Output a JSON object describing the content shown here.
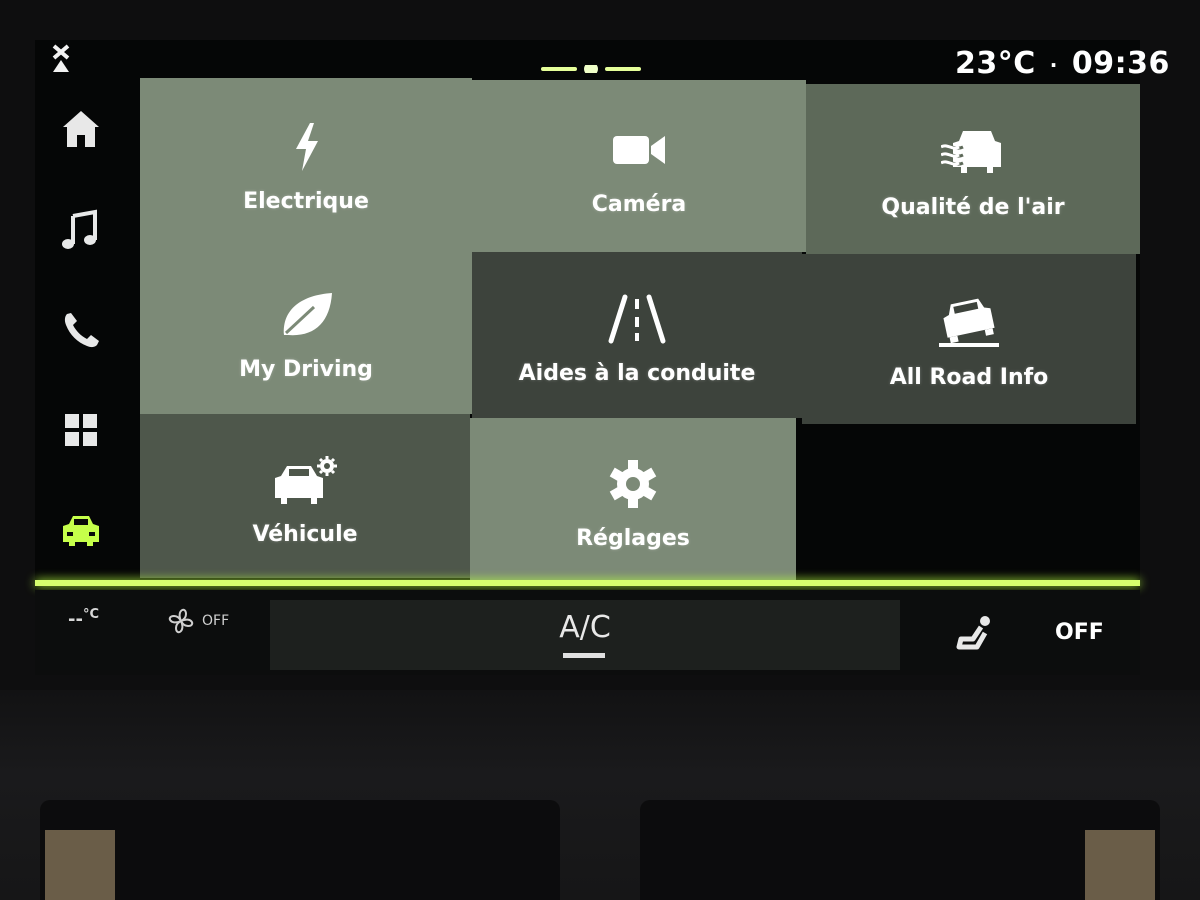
{
  "status_bar": {
    "temperature": "23°C",
    "separator": "·",
    "time": "09:36"
  },
  "sidebar": {
    "items": [
      {
        "icon": "home-icon",
        "selected": false
      },
      {
        "icon": "music-icon",
        "selected": false
      },
      {
        "icon": "phone-icon",
        "selected": false
      },
      {
        "icon": "apps-grid-icon",
        "selected": false
      },
      {
        "icon": "car-icon",
        "selected": true
      }
    ],
    "accent_color": "#c6ff4a"
  },
  "tiles": [
    {
      "label": "Electrique",
      "icon": "lightning-icon"
    },
    {
      "label": "Caméra",
      "icon": "video-camera-icon"
    },
    {
      "label": "Qualité de l'air",
      "icon": "air-quality-car-icon"
    },
    {
      "label": "My Driving",
      "icon": "leaf-icon"
    },
    {
      "label": "Aides à la conduite",
      "icon": "road-lanes-icon"
    },
    {
      "label": "All Road Info",
      "icon": "tilted-car-icon"
    },
    {
      "label": "Véhicule",
      "icon": "car-settings-icon"
    },
    {
      "label": "Réglages",
      "icon": "gear-icon"
    }
  ],
  "climate": {
    "temperature": "--",
    "temperature_unit": "°C",
    "fan_state": "OFF",
    "ac_label": "A/C",
    "seat_heat_state": "OFF"
  }
}
